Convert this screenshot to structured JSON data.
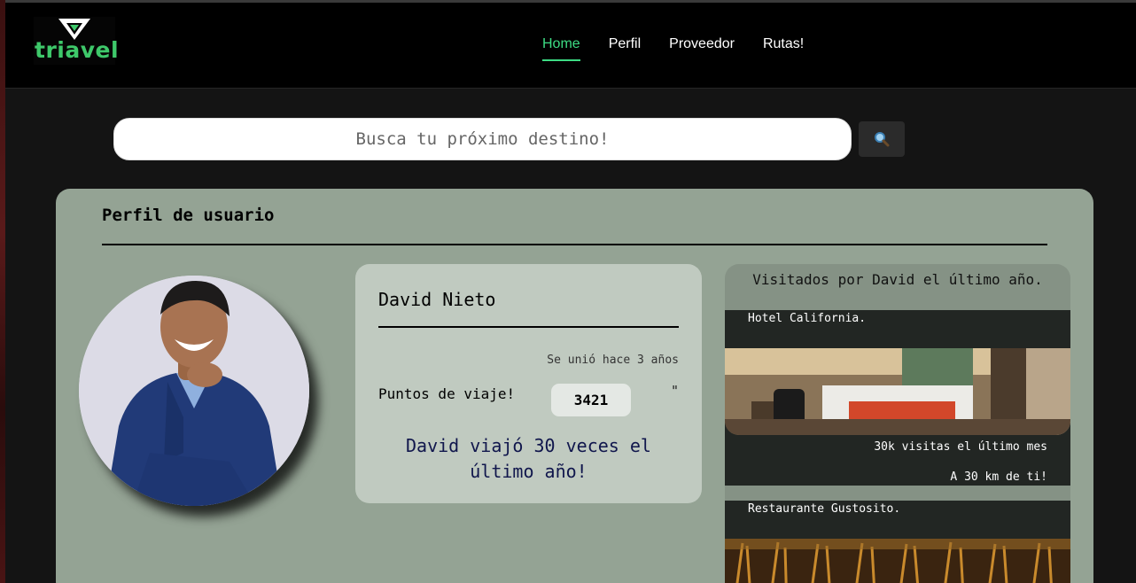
{
  "brand": {
    "name": "triavel",
    "color": "#3ec86a"
  },
  "nav": {
    "items": [
      {
        "label": "Home",
        "active": true
      },
      {
        "label": "Perfil",
        "active": false
      },
      {
        "label": "Proveedor",
        "active": false
      },
      {
        "label": "Rutas!",
        "active": false
      }
    ],
    "active_color": "#3ddc84"
  },
  "search": {
    "placeholder": "Busca tu próximo destino!",
    "button_icon": "search-icon"
  },
  "profile": {
    "section_title": "Perfil de usuario",
    "name": "David Nieto",
    "joined": "Se unió hace 3 años",
    "points_label": "Puntos de viaje!",
    "points": "3421",
    "stray_mark": "\"",
    "summary": "David viajó 30 veces el último año!"
  },
  "visited": {
    "title": "Visitados por David el último año.",
    "places": [
      {
        "name": "Hotel California.",
        "visits": "30k visitas el último mes",
        "distance": "A 30 km de ti!"
      },
      {
        "name": "Restaurante Gustosito."
      }
    ]
  },
  "colors": {
    "panel": "#94a394",
    "card": "#c0cac0",
    "place_bg": "#222623"
  }
}
